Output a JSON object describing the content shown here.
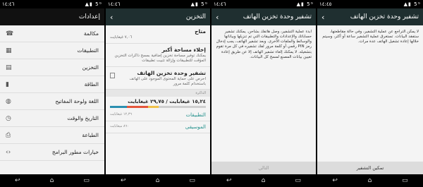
{
  "screens": [
    {
      "time": "١٤:٤٦",
      "title": "إعدادات",
      "items": [
        {
          "label": "مكالمة",
          "icon": "phone-icon",
          "glyph": "☎"
        },
        {
          "label": "التطبيقات",
          "icon": "apps-grid-icon",
          "glyph": "▦"
        },
        {
          "label": "التخزين",
          "icon": "storage-icon",
          "glyph": "▤"
        },
        {
          "label": "الطاقة",
          "icon": "battery-icon",
          "glyph": "▮"
        },
        {
          "label": "اللغة ولوحة المفاتيح",
          "icon": "globe-icon",
          "glyph": "◍"
        },
        {
          "label": "التاريخ والوقت",
          "icon": "clock-icon",
          "glyph": "◷"
        },
        {
          "label": "الطباعة",
          "icon": "printer-icon",
          "glyph": "⎙"
        },
        {
          "label": "خيارات مطور البرامج",
          "icon": "code-icon",
          "glyph": "‹›"
        }
      ]
    },
    {
      "time": "١٤:٤٦",
      "title": "التخزين",
      "available_label": "متاح",
      "available_size": "٧,٠٦ غيغابايت",
      "free_title": "إخلاء مساحة أكبر",
      "free_sub": "يمكنك توفير مساحة تخزين إضافية بمسح ذاكرات التخزين المؤقت للتطبيقات وإزالة تثبيت تطبيقات",
      "encrypt_title": "تشفير وحدة تخزين الهاتف",
      "encrypt_sub": "احرص على حماية المحتوى الموجود على الهاتف باستخدام كلمة مرور",
      "section": "الذاكرة",
      "usage": "١٥,٢٤ غيغابايت / ٢٩,٧٥ غيغابايت",
      "apps_label": "التطبيقات",
      "apps_size": "١٢,٣٦ غيغابايت",
      "music_label": "الموسيقى",
      "music_size": "٨٦٠ ميغابايت"
    },
    {
      "time": "١٤:٤٦",
      "title": "تشفير وحدة تخزين الهاتف",
      "body": "ابدء عملية التشفير، وصل هاتفك بشاحن. يمكنك تشفير حساباتك والإعدادات والتطبيقات التي تم تنزيلها وبياناتها والوسائط والملفات الأخرى. وبعد تشفير الهاتف، يجب إدخال رمز PIN رقمي أو كلمة مرور لفك تشفيره في كل مرة تقوم بتشغيله. لا يمكنك إلغاء تشفير الهاتف إلا عن طريق إعادة تعيين بيانات المصنع لمسح كل البيانات.",
      "button": "التالي"
    },
    {
      "time": "١٤:٤٥",
      "title": "تشفير وحدة تخزين الهاتف",
      "body": "لا يمكن التراجع عن عملية التشفير، وفي حالة مقاطعتها، ستفقد البيانات. تستغرق عملية التشفير ساعة أو أكثر، وسيتم خلالها إعادة تشغيل الهاتف عدة مرات.",
      "button": "تمكين التشفير"
    }
  ],
  "colors": {
    "bar_used": "#2b8fb0",
    "bar_apps": "#e5563c",
    "bar_other": "#f0c24a",
    "bar_free": "#cfcfcf"
  }
}
